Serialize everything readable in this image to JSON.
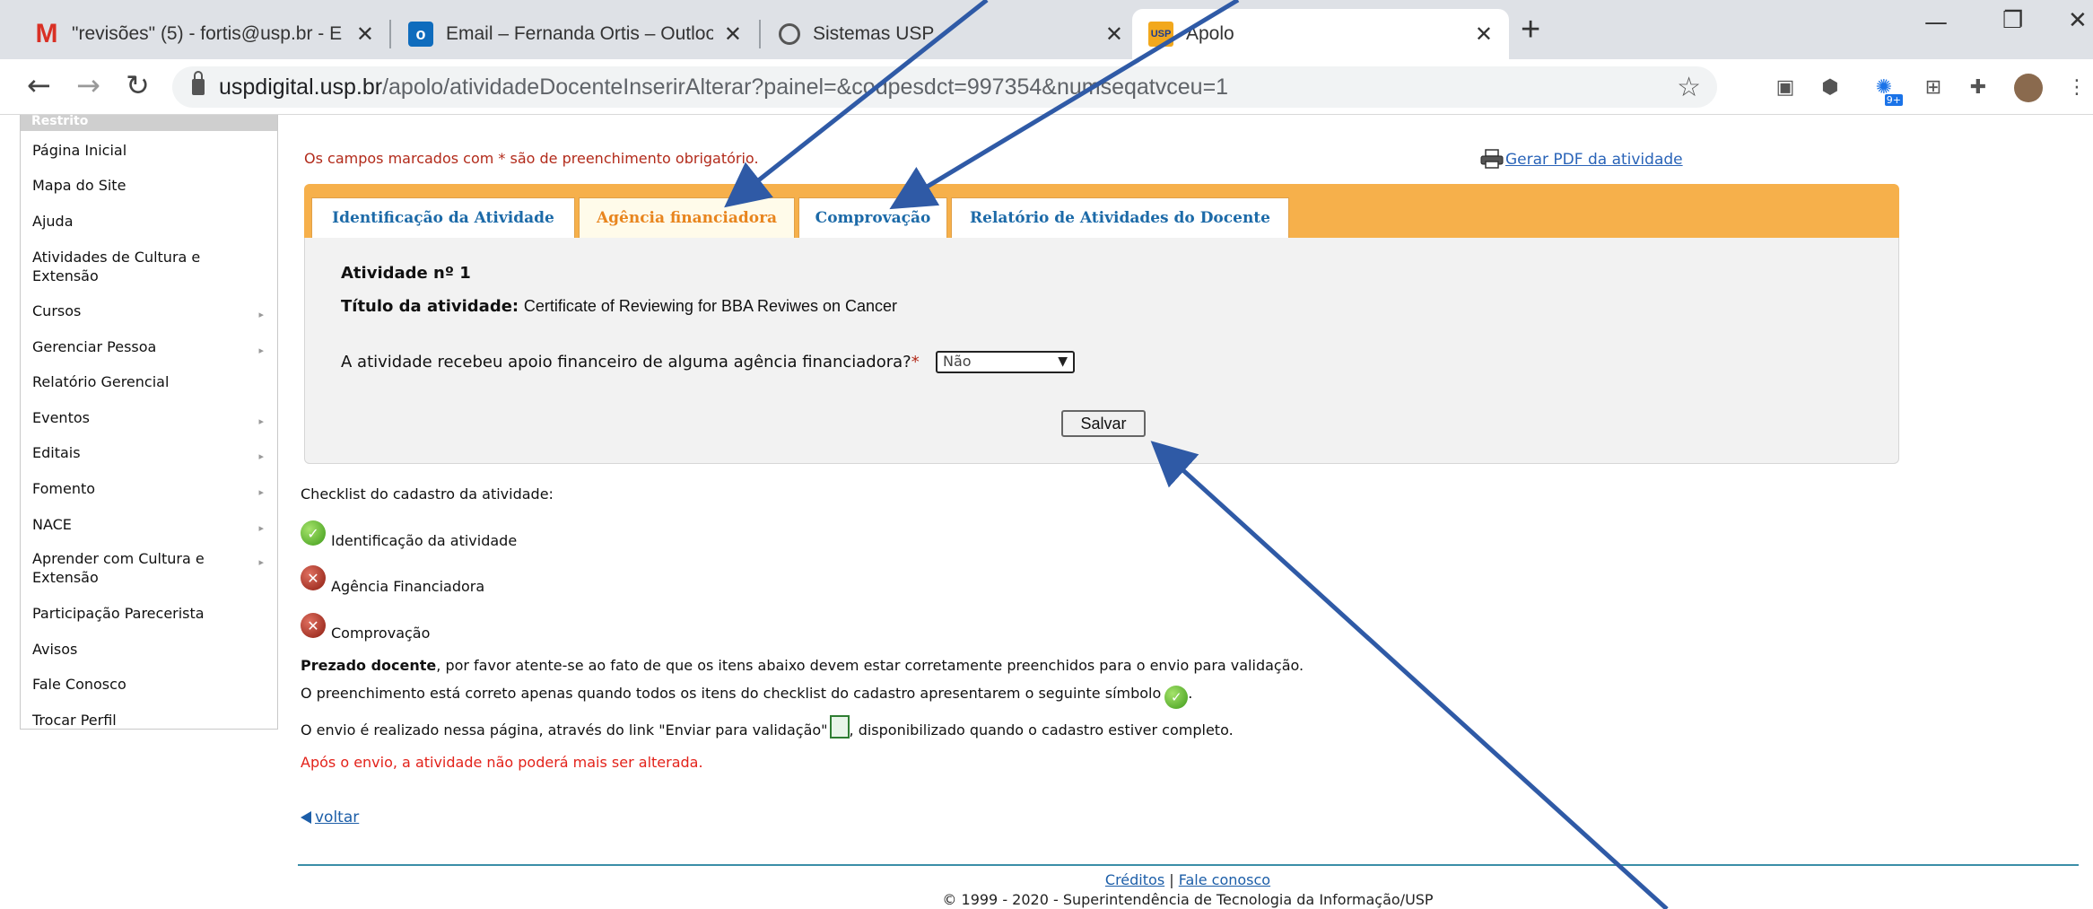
{
  "browser": {
    "tabs": [
      {
        "label": "\"revisões\" (5) - fortis@usp.br - E",
        "icon": "gmail-icon"
      },
      {
        "label": "Email – Fernanda Ortis – Outlook",
        "icon": "outlook-icon"
      },
      {
        "label": "Sistemas USP",
        "icon": "globe-icon"
      },
      {
        "label": "Apolo",
        "icon": "usp-icon",
        "icon_text": "USP"
      }
    ],
    "url_host": "uspdigital.usp.br",
    "url_path": "/apolo/atividadeDocenteInserirAlterar?painel=&codpesdct=997354&numseqatvceu=1",
    "extension_badge": "9+"
  },
  "sidebar": {
    "header": "Restrito",
    "items": [
      {
        "label": "Página Inicial",
        "has_submenu": false
      },
      {
        "label": "Mapa do Site",
        "has_submenu": false
      },
      {
        "label": "Ajuda",
        "has_submenu": false
      },
      {
        "label": "Atividades de Cultura e Extensão",
        "has_submenu": false
      },
      {
        "label": "Cursos",
        "has_submenu": true
      },
      {
        "label": "Gerenciar Pessoa",
        "has_submenu": true
      },
      {
        "label": "Relatório Gerencial",
        "has_submenu": false
      },
      {
        "label": "Eventos",
        "has_submenu": true
      },
      {
        "label": "Editais",
        "has_submenu": true
      },
      {
        "label": "Fomento",
        "has_submenu": true
      },
      {
        "label": "NACE",
        "has_submenu": true
      },
      {
        "label": "Aprender com Cultura e Extensão",
        "has_submenu": true
      },
      {
        "label": "Participação Parecerista",
        "has_submenu": false
      },
      {
        "label": "Avisos",
        "has_submenu": false
      },
      {
        "label": "Fale Conosco",
        "has_submenu": false
      },
      {
        "label": "Trocar Perfil",
        "has_submenu": false
      }
    ]
  },
  "main": {
    "required_note": "Os campos marcados com * são de preenchimento obrigatório.",
    "pdf_link": "Gerar PDF da atividade",
    "tabs": [
      {
        "label": "Identificação da Atividade",
        "active": false
      },
      {
        "label": "Agência financiadora",
        "active": true
      },
      {
        "label": "Comprovação",
        "active": false
      },
      {
        "label": "Relatório de Atividades do Docente",
        "active": false
      }
    ],
    "activity_number_label": "Atividade nº 1",
    "activity_title_label": "Título da atividade:",
    "activity_title_value": "Certificate of Reviewing for BBA Reviwes on Cancer",
    "funding_question": "A atividade recebeu apoio financeiro de alguma agência financiadora?",
    "required_mark": "*",
    "funding_select_value": "Não",
    "save_label": "Salvar",
    "checklist_title": "Checklist do cadastro da atividade:",
    "checklist": [
      {
        "label": "Identificação da atividade",
        "status": "ok"
      },
      {
        "label": "Agência Financiadora",
        "status": "error"
      },
      {
        "label": "Comprovação",
        "status": "error"
      }
    ],
    "notice_bold": "Prezado docente",
    "notice_rest": ", por favor atente-se ao fato de que os itens abaixo devem estar corretamente preenchidos para o envio para validação.",
    "notice_line2": "O preenchimento está correto apenas quando todos os itens do checklist do cadastro apresentarem o seguinte símbolo",
    "notice_line3_a": "O envio é realizado nessa página, através do link \"Enviar para validação\"",
    "notice_line3_b": ", disponibilizado quando o cadastro estiver completo.",
    "after_send_note": "Após o envio, a atividade não poderá mais ser alterada.",
    "back_link": "voltar"
  },
  "footer": {
    "credits": "Créditos",
    "separator": "|",
    "contact": "Fale conosco",
    "copyright": "© 1999 - 2020 - Superintendência de Tecnologia da Informação/USP"
  },
  "colors": {
    "tab_strip": "#f6b04b",
    "active_tab_text": "#e8851e",
    "tab_text": "#1c6aa8",
    "required_red": "#b22a1a",
    "warning_red": "#e3221a",
    "annotation_arrow": "#2f5aa6"
  }
}
